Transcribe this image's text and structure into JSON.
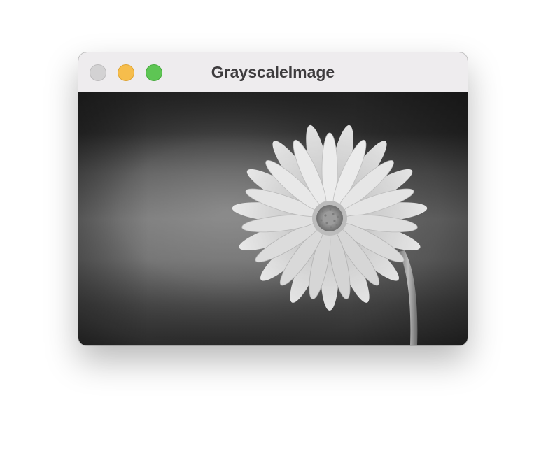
{
  "window": {
    "title": "GrayscaleImage",
    "controls": [
      "close-button",
      "minimize-button",
      "zoom-button"
    ]
  },
  "image": {
    "subject": "daisy-flower",
    "color_mode": "grayscale"
  }
}
